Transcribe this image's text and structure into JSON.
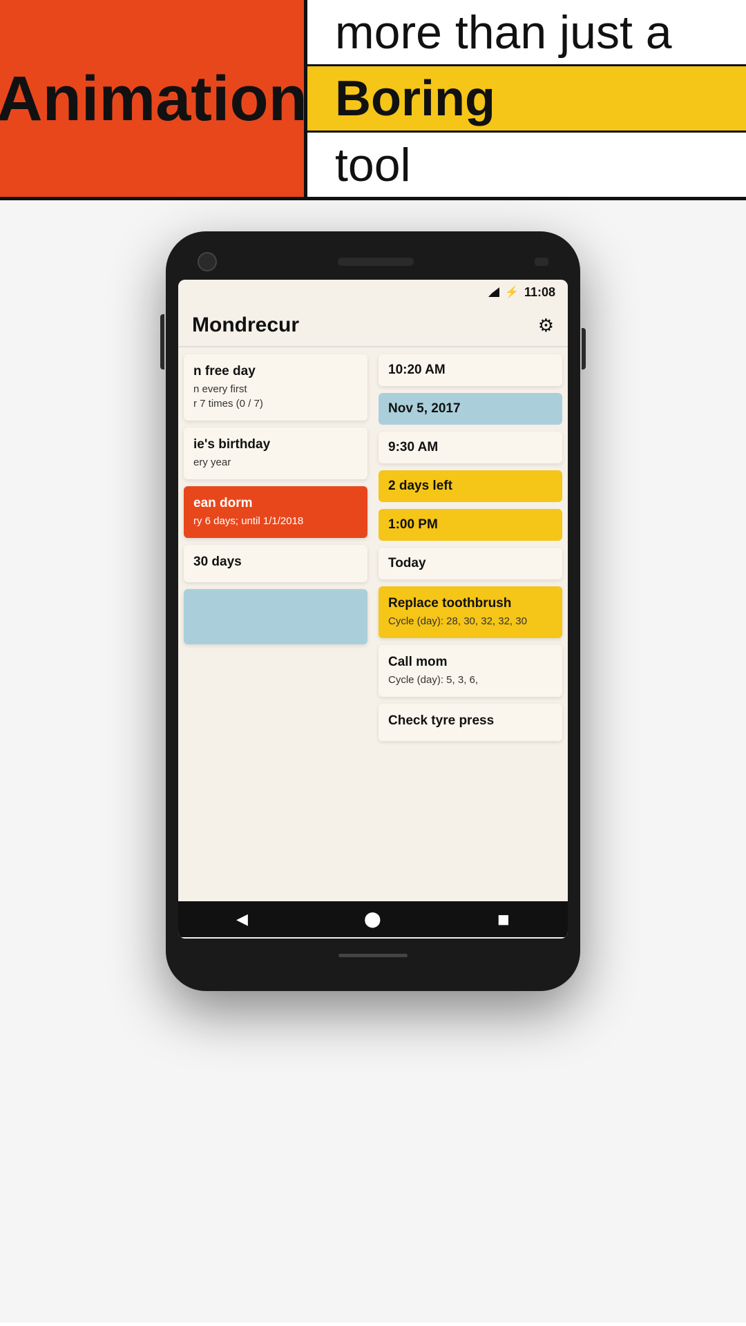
{
  "hero": {
    "left_title": "Animation",
    "row_top": "more than just a",
    "row_middle": "Boring",
    "row_bottom": "tool"
  },
  "app": {
    "title": "Mondrecur",
    "status_time": "11:08",
    "tasks": [
      {
        "id": "task1",
        "name": "n free day",
        "detail": "n every first\nr 7 times (0 / 7)",
        "style": "default",
        "time": "10:20 AM",
        "date": "Nov 5, 2017",
        "date_style": "blue"
      },
      {
        "id": "task2",
        "name": "ie's birthday",
        "detail": "ery year",
        "style": "default",
        "time": "9:30 AM",
        "days_left": "2 days left",
        "time2": "1:00 PM",
        "today": "Today"
      },
      {
        "id": "task3",
        "name": "ean dorm",
        "detail": "ry 6 days; until 1/1/2018",
        "style": "orange"
      },
      {
        "id": "task4",
        "name": "30 days",
        "style": "default"
      }
    ],
    "right_tasks": [
      {
        "id": "rt1",
        "name": "Replace toothbrush",
        "detail": "Cycle (day): 28, 30, 32, 32, 30",
        "style": "yellow"
      },
      {
        "id": "rt2",
        "name": "Call mom",
        "detail": "Cycle (day): 5, 3, 6,",
        "style": "white"
      },
      {
        "id": "rt3",
        "name": "Check tyre press",
        "style": "white"
      }
    ],
    "nav": {
      "back": "◀",
      "home": "⬤",
      "recent": "◼"
    }
  }
}
